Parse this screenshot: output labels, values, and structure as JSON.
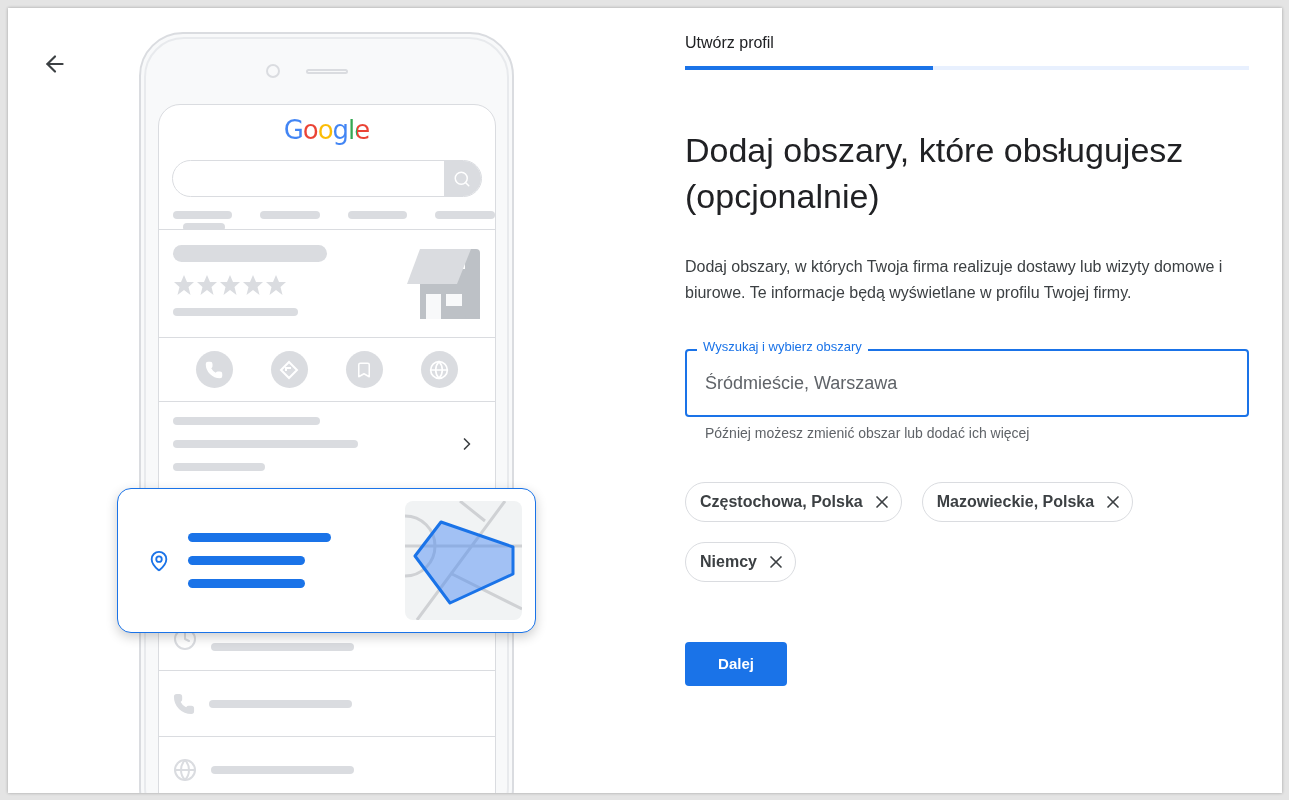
{
  "header": {
    "title": "Utwórz profil",
    "progress": {
      "level": 0.44
    }
  },
  "illustration": {
    "logo": "Google"
  },
  "heading": "Dodaj obszary, które obsługujesz (opcjonalnie)",
  "description": "Dodaj obszary, w których Twoja firma realizuje dostawy lub wizyty domowe i biurowe. Te informacje będą wyświetlane w profilu Twojej firmy.",
  "search_field": {
    "label": "Wyszukaj i wybierz obszary",
    "placeholder": "Śródmieście, Warszawa",
    "helper": "Później możesz zmienić obszar lub dodać ich więcej"
  },
  "chips": [
    {
      "label": "Częstochowa, Polska"
    },
    {
      "label": "Mazowieckie, Polska"
    },
    {
      "label": "Niemcy"
    }
  ],
  "buttons": [
    {
      "label": "Dalej",
      "kind": "primary"
    }
  ]
}
